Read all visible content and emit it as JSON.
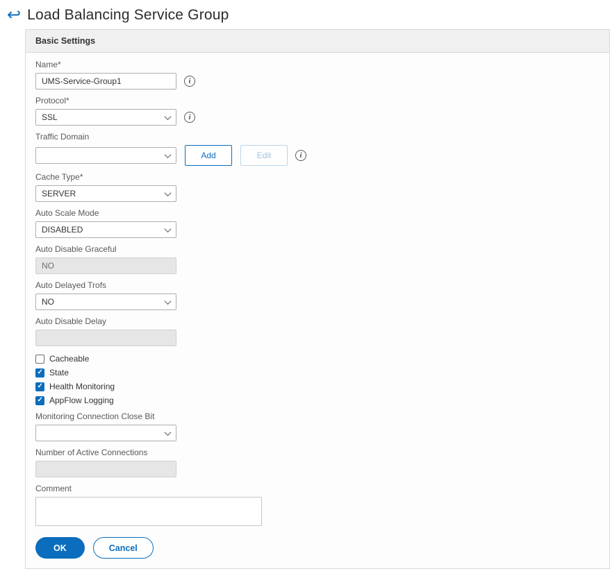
{
  "colors": {
    "accent": "#0b6dbd",
    "panel_header_bg": "#f0f0f0",
    "panel_border": "#d8d8d8",
    "disabled_input_bg": "#e6e6e6"
  },
  "icons": {
    "back_arrow": "↩",
    "info": "i"
  },
  "header": {
    "title": "Load Balancing Service Group"
  },
  "panel": {
    "title": "Basic Settings"
  },
  "fields": {
    "name": {
      "label": "Name*",
      "value": "UMS-Service-Group1"
    },
    "protocol": {
      "label": "Protocol*",
      "value": "SSL"
    },
    "traffic_domain": {
      "label": "Traffic Domain",
      "value": "",
      "add": "Add",
      "edit": "Edit"
    },
    "cache_type": {
      "label": "Cache Type*",
      "value": "SERVER"
    },
    "auto_scale_mode": {
      "label": "Auto Scale Mode",
      "value": "DISABLED"
    },
    "auto_disable_graceful": {
      "label": "Auto Disable Graceful",
      "value": "NO"
    },
    "auto_delayed_trofs": {
      "label": "Auto Delayed Trofs",
      "value": "NO"
    },
    "auto_disable_delay": {
      "label": "Auto Disable Delay",
      "value": ""
    },
    "monitoring_connection_close_bit": {
      "label": "Monitoring Connection Close Bit",
      "value": ""
    },
    "number_of_active_connections": {
      "label": "Number of Active Connections",
      "value": ""
    },
    "comment": {
      "label": "Comment",
      "value": ""
    }
  },
  "checkboxes": [
    {
      "label": "Cacheable",
      "checked": false
    },
    {
      "label": "State",
      "checked": true
    },
    {
      "label": "Health Monitoring",
      "checked": true
    },
    {
      "label": "AppFlow Logging",
      "checked": true
    }
  ],
  "actions": {
    "ok": "OK",
    "cancel": "Cancel"
  }
}
